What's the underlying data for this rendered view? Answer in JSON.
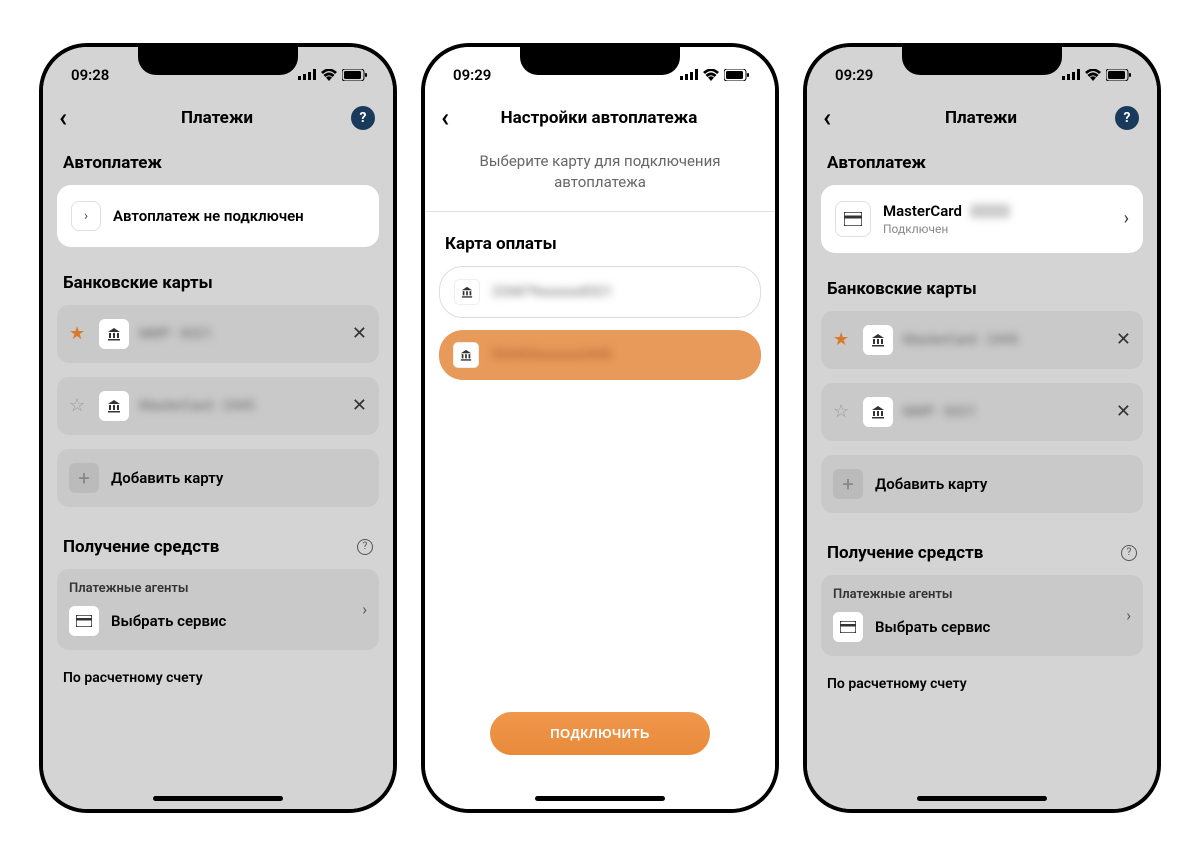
{
  "screen1": {
    "time": "09:28",
    "title": "Платежи",
    "autopay_section": "Автоплатеж",
    "autopay_status": "Автоплатеж не подключен",
    "cards_section": "Банковские карты",
    "card1_masked": "МИР - 8321",
    "card2_masked": "MasterCard - 2445",
    "add_card": "Добавить карту",
    "funds_section": "Получение средств",
    "agents_title": "Платежные агенты",
    "agents_action": "Выбрать сервис",
    "account_text": "По расчетному счету"
  },
  "screen2": {
    "time": "09:29",
    "title": "Настройки автоплатежа",
    "subtitle": "Выберите карту для подключения автоплатежа",
    "paycard_section": "Карта оплаты",
    "card1_masked": "226879xxxxxx8321",
    "card2_masked": "553453xxxxxx2445",
    "connect_btn": "ПОДКЛЮЧИТЬ"
  },
  "screen3": {
    "time": "09:29",
    "title": "Платежи",
    "autopay_section": "Автоплатеж",
    "autopay_card": "MasterCard",
    "autopay_status": "Подключен",
    "cards_section": "Банковские карты",
    "card1_masked": "MasterCard - 2445",
    "card2_masked": "МИР - 8321",
    "add_card": "Добавить карту",
    "funds_section": "Получение средств",
    "agents_title": "Платежные агенты",
    "agents_action": "Выбрать сервис",
    "account_text": "По расчетному счету"
  },
  "colors": {
    "accent": "#e88a3a",
    "help_bg": "#1a3a5c",
    "star_filled": "#d97a2a"
  }
}
